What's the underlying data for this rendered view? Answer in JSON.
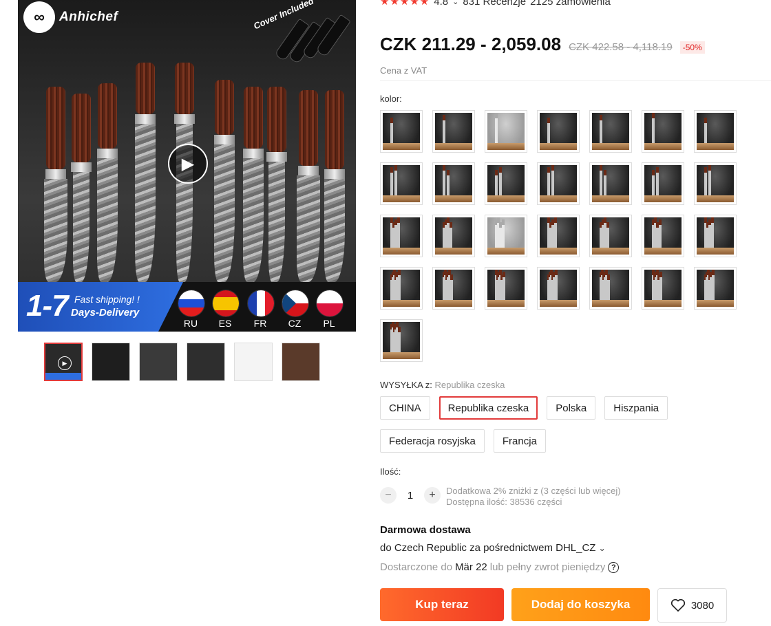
{
  "gallery": {
    "brand": "Anhichef",
    "cover_text": "Cover Included",
    "shipping_big": "1-7",
    "shipping_line1": "Fast shipping! !",
    "shipping_line2": "Days-Delivery",
    "flags": [
      "RU",
      "ES",
      "FR",
      "CZ",
      "PL"
    ],
    "thumbnail_count": 6
  },
  "product": {
    "rating_value": "4.8",
    "reviews": "831 Recenzje",
    "orders": "2125 zamówienia",
    "price": "CZK 211.29 - 2,059.08",
    "old_price": "CZK 422.58 - 4,118.19",
    "discount": "-50%",
    "vat_note": "Cena z VAT"
  },
  "colors": {
    "label": "kolor:",
    "swatch_count": 29
  },
  "shipping_from": {
    "label": "WYSYŁKA z:",
    "value": "Republika czeska",
    "options": [
      "CHINA",
      "Republika czeska",
      "Polska",
      "Hiszpania",
      "Federacja rosyjska",
      "Francja"
    ],
    "selected": "Republika czeska"
  },
  "quantity": {
    "label": "Ilość:",
    "value": "1",
    "info_line1": "Dodatkowa 2% zniżki z (3 części lub więcej)",
    "info_line2": "Dostępna ilość: 38536 części"
  },
  "delivery": {
    "title": "Darmowa dostawa",
    "route": "do Czech Republic za pośrednictwem DHL_CZ",
    "prefix": "Dostarczone do",
    "date": "Mär 22",
    "suffix": "lub pełny zwrot pieniędzy"
  },
  "actions": {
    "buy_now": "Kup teraz",
    "add_to_cart": "Dodaj do koszyka",
    "wish_count": "3080"
  },
  "colors_theme": {
    "accent_red": "#f23a24",
    "accent_orange": "#ff8a10",
    "selected_border": "#e23b3b"
  }
}
